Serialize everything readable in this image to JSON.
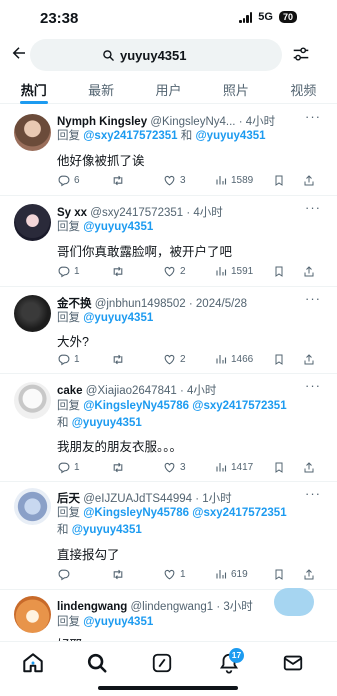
{
  "status_bar": {
    "time": "23:38",
    "network": "5G",
    "battery": "70"
  },
  "search": {
    "query": "yuyuy4351"
  },
  "tabs": [
    {
      "label": "热门",
      "active": true
    },
    {
      "label": "最新",
      "active": false
    },
    {
      "label": "用户",
      "active": false
    },
    {
      "label": "照片",
      "active": false
    },
    {
      "label": "视频",
      "active": false
    }
  ],
  "tweets": [
    {
      "name": "Nymph Kingsley",
      "handle": "@KingsleyNy4...",
      "time": "· 4小时",
      "reply_prefix": "回复",
      "mention1": "@sxy2417572351",
      "reply_and": "和",
      "mention2": "@yuyuy4351",
      "mention3": "",
      "text": "他好像被抓了诶",
      "replies": "6",
      "retweets": "",
      "likes": "3",
      "views": "1589"
    },
    {
      "name": "Sy xx",
      "handle": "@sxy2417572351",
      "time": "· 4小时",
      "reply_prefix": "回复",
      "mention1": "@yuyuy4351",
      "text": "哥们你真敢露脸啊，被开户了吧",
      "replies": "1",
      "retweets": "",
      "likes": "2",
      "views": "1591"
    },
    {
      "name": "金不换",
      "handle": "@jnbhun1498502",
      "time": "· 2024/5/28",
      "reply_prefix": "回复",
      "mention1": "@yuyuy4351",
      "text": "大外?",
      "replies": "1",
      "retweets": "",
      "likes": "2",
      "views": "1466"
    },
    {
      "name": "cake",
      "handle": "@Xiajiao2647841",
      "time": "· 4小时",
      "reply_prefix": "回复",
      "mention1": "@KingsleyNy45786",
      "mention2": "@sxy2417572351",
      "reply_and": "和",
      "mention3": "@yuyuy4351",
      "text": "我朋友的朋友衣服。。。",
      "replies": "1",
      "retweets": "",
      "likes": "3",
      "views": "1417"
    },
    {
      "name": "后天",
      "handle": "@eIJZUAJdTS44994",
      "time": "· 1小时",
      "reply_prefix": "回复",
      "mention1": "@KingsleyNy45786",
      "mention2": "@sxy2417572351",
      "reply_and": "和",
      "mention3": "@yuyuy4351",
      "text": "直接报勾了",
      "replies": "",
      "retweets": "",
      "likes": "1",
      "views": "619"
    },
    {
      "name": "lindengwang",
      "handle": "@lindengwang1",
      "time": "· 3小时",
      "reply_prefix": "回复",
      "mention1": "@yuyuy4351",
      "text": "好耶"
    }
  ],
  "bottom_nav": {
    "notification_count": "17"
  },
  "colors": {
    "accent": "#1d9bf0",
    "text": "#0f1419",
    "muted": "#536471",
    "search_bg": "#eff3f4"
  }
}
